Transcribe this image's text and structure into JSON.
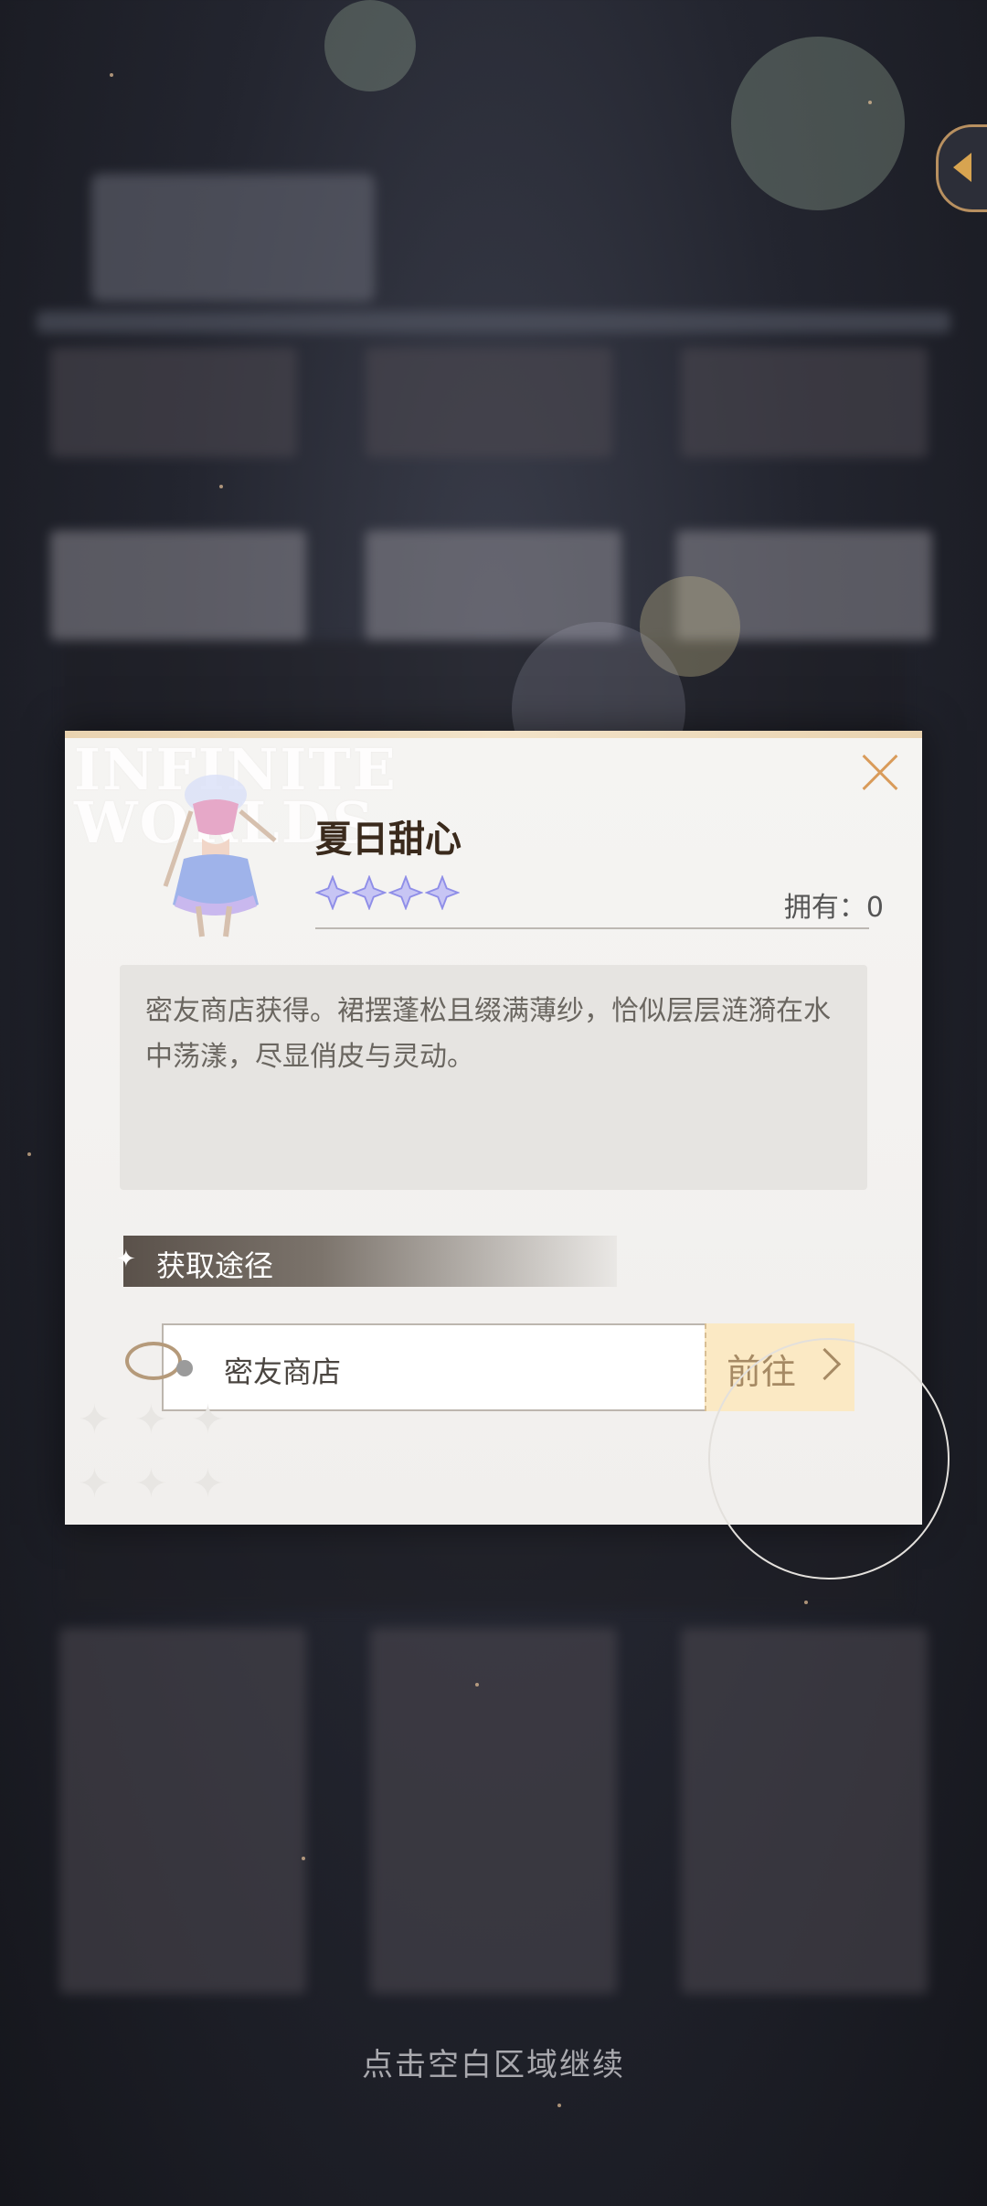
{
  "item": {
    "name": "夏日甜心",
    "rarity_stars": 4,
    "owned_label": "拥有：",
    "owned_count": "0",
    "description": "密友商店获得。裙摆蓬松且缀满薄纱，恰似层层涟漪在水中荡漾，尽显俏皮与灵动。"
  },
  "watermark": {
    "line1": "INFINITE",
    "line2": "WORLDS"
  },
  "acquire": {
    "section_title": "获取途径",
    "source_label": "密友商店",
    "go_label": "前往"
  },
  "footer": {
    "continue_hint": "点击空白区域继续"
  },
  "colors": {
    "accent": "#d99b5a",
    "go_button_bg": "#fbe9c4",
    "star": "#8f8ee8"
  },
  "icons": [
    "close-icon",
    "star-icon",
    "chevron-right-icon",
    "diamond-icon",
    "back-arrow-icon"
  ]
}
